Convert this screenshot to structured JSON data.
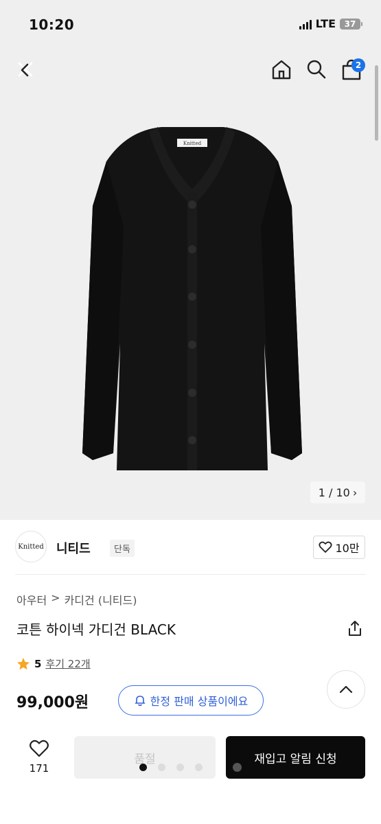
{
  "status": {
    "time": "10:20",
    "network": "LTE",
    "battery": "37"
  },
  "header": {
    "cart_count": "2"
  },
  "gallery": {
    "pager": "1 / 10",
    "pager_arrow": "›",
    "image_label": "Knitted"
  },
  "brand": {
    "logo_text": "Knitted",
    "name": "니티드",
    "tag": "단독",
    "likes": "10만"
  },
  "breadcrumb": [
    "아우터",
    ">",
    "카디건 (니티드)"
  ],
  "product": {
    "title": "코튼 하이넥 가디건 BLACK",
    "rating": "5",
    "reviews": "후기 22개",
    "price": "99,000원",
    "limited_label": "한정 판매 상품이에요"
  },
  "bottom": {
    "wish_count": "171",
    "soldout_label": "품절",
    "notify_label": "재입고 알림 신청"
  },
  "colors": {
    "accent": "#3b6ee8",
    "badge": "#1a73e8",
    "star": "#f5a623",
    "primary_button": "#0b0b0b"
  }
}
